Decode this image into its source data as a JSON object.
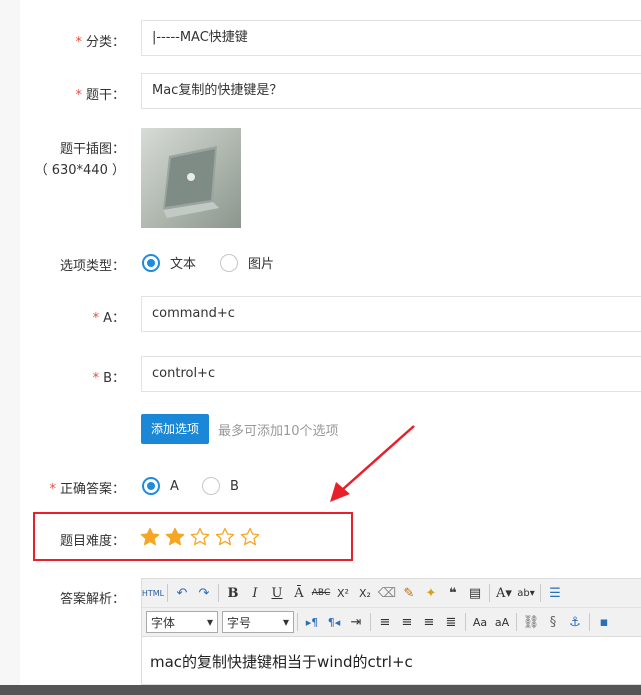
{
  "category": {
    "label": "分类：",
    "value": "|-----MAC快捷键"
  },
  "stem": {
    "label": "题干：",
    "value": "Mac复制的快捷键是？"
  },
  "stem_image": {
    "label_line1": "题干插图：",
    "label_line2": "（ 630*440 ）"
  },
  "option_type": {
    "label": "选项类型：",
    "options": [
      "文本",
      "图片"
    ],
    "selected": "文本"
  },
  "option_a": {
    "label": "A：",
    "value": "command+c"
  },
  "option_b": {
    "label": "B：",
    "value": "control+c"
  },
  "add_option": {
    "button_label": "添加选项",
    "hint": "最多可添加10个选项"
  },
  "correct_answer": {
    "label": "正确答案：",
    "options": [
      "A",
      "B"
    ],
    "selected": "A"
  },
  "difficulty": {
    "label": "题目难度：",
    "rating": 2,
    "max": 5,
    "star_color": "#f5a623"
  },
  "analysis": {
    "label": "答案解析：",
    "font_select": "字体",
    "size_select": "字号",
    "content": "mac的复制快捷键相当于wind的ctrl+c"
  },
  "required_mark": "*",
  "annotation_color": "#e8202a"
}
